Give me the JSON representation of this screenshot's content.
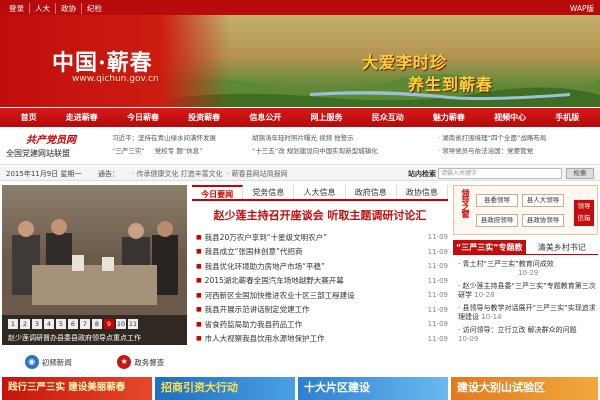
{
  "topbar": {
    "links": [
      "登录",
      "人大",
      "政协",
      "纪检"
    ],
    "wap": "WAP版"
  },
  "banner": {
    "site_name": "中国·蕲春",
    "site_url": "www.qichun.gov.cn",
    "slogan1": "大爱李时珍",
    "slogan2": "养生到蕲春"
  },
  "nav": [
    "首页",
    "走进蕲春",
    "今日蕲春",
    "投资蕲春",
    "信息公开",
    "网上服务",
    "民众互动",
    "魅力蕲春",
    "视频中心",
    "手机版"
  ],
  "party_logo": {
    "line1": "共产党员网",
    "line2": "全国党建网站联盟"
  },
  "ticker": {
    "col1": [
      "习近平：坚持在青山绿水间满怀发展",
      "“三严三实”",
      "党校专 题“休息”"
    ],
    "col2": [
      "胡锦涛年轻时照片曝光 视频 他警示",
      "“十三五”改 规划建设向中国实现新型城镇化"
    ],
    "col3": [
      "· 湖南省打围境理“四个全面”战略布局",
      "· 领导党员与依法治国：党要管党"
    ]
  },
  "datebar": {
    "date": "2015年11月9日 星期一",
    "notice_label": "通告：",
    "notice": "· 传承健康文化 打造丰富文化",
    "notice2": "· 蕲春县网站简报网",
    "search_label": "站内检索",
    "search_placeholder": "请输入关键字",
    "search_button": "检索"
  },
  "slideshow": {
    "pages": [
      "1",
      "2",
      "3",
      "4",
      "5",
      "6",
      "7",
      "8",
      "9",
      "10",
      "11"
    ],
    "current": "9",
    "caption": "赵少莲调研督办县委县政府领导点重点工作"
  },
  "sub_links": {
    "item1": "初频新闻",
    "item2": "政务督查"
  },
  "tabs": [
    "今日要闻",
    "党务信息",
    "人大信息",
    "政府信息",
    "政协信息"
  ],
  "headline": "赵少莲主持召开座谈会  听取主题调研讨论汇",
  "news": [
    {
      "title": "我县20万农户享到“十星级文明农户”",
      "date": "11-09"
    },
    {
      "title": "我县成立“张国林创意”代招商",
      "date": "11-09"
    },
    {
      "title": "我县优化环境助力房地产市场“平稳”",
      "date": "11-09"
    },
    {
      "title": "2015湖北蕲春全国汽车场地越野大赛开幕",
      "date": "11-09"
    },
    {
      "title": "河西新区全国加快推进农业十区三部工程建设",
      "date": "11-09"
    },
    {
      "title": "我县开展示范讲话制定党建工作",
      "date": "11-09"
    },
    {
      "title": "省食药监局助力我县药品工作",
      "date": "11-09"
    },
    {
      "title": "市人大视察我县饮用水源地保护工作",
      "date": "11-09"
    }
  ],
  "right_panel": {
    "label": "领导之窗",
    "buttons": [
      "县委领导",
      "县人大领导",
      "县政府领导",
      "县政协领导"
    ],
    "mark": "领导 信箱"
  },
  "right_tabs": [
    "“三严三实”专题教育",
    "清美乡村书记"
  ],
  "right_list": [
    "· 青土村“三严三实”教育问成效",
    "10-29",
    "· 赵少莲主持县委“三严三实”专题教育第三次研学",
    "10-28",
    "· 县领导与教学对话展开“三严三实”实现追求理建设",
    "10-14",
    "· 访问领导：立行立改 解决群众的问题",
    "10-09"
  ],
  "bottom_banners": [
    "践行三严三实 建设美丽蕲春",
    "招商引资大行动",
    "十大片区建设",
    "建设大别山试验区"
  ],
  "colors": {
    "primary_red": "#c30d0d",
    "nav_red": "#c81414",
    "gold": "#f9d23a"
  }
}
